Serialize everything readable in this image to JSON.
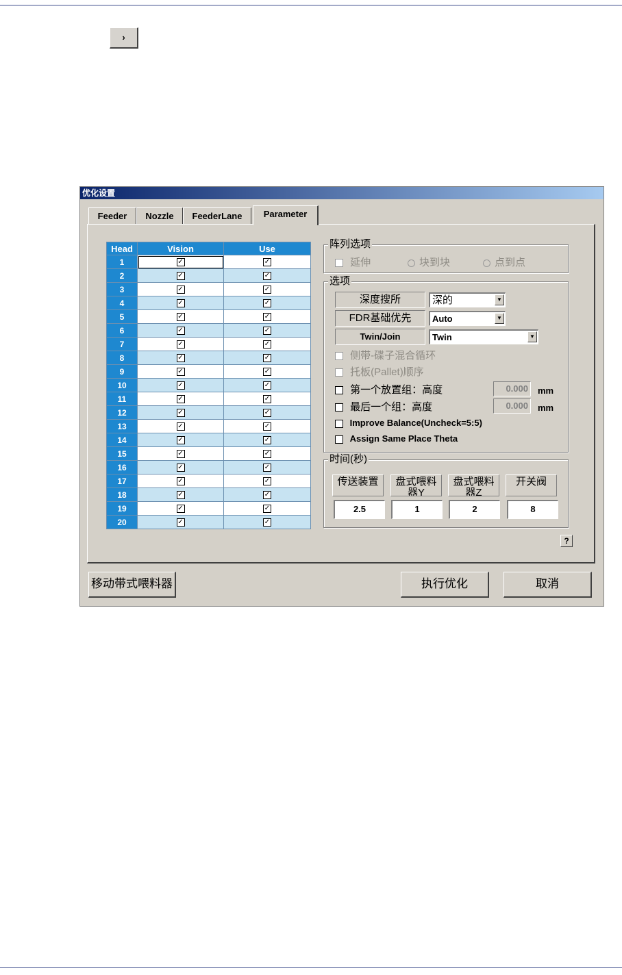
{
  "page": {
    "nav_button_label": "›"
  },
  "dialog": {
    "title": "优化设置",
    "tabs": [
      "Feeder",
      "Nozzle",
      "FeederLane",
      "Parameter"
    ],
    "active_tab": "Parameter",
    "head_table": {
      "columns": [
        "Head",
        "Vision",
        "Use"
      ],
      "rows": [
        {
          "head": "1",
          "vision": true,
          "use": true
        },
        {
          "head": "2",
          "vision": true,
          "use": true
        },
        {
          "head": "3",
          "vision": true,
          "use": true
        },
        {
          "head": "4",
          "vision": true,
          "use": true
        },
        {
          "head": "5",
          "vision": true,
          "use": true
        },
        {
          "head": "6",
          "vision": true,
          "use": true
        },
        {
          "head": "7",
          "vision": true,
          "use": true
        },
        {
          "head": "8",
          "vision": true,
          "use": true
        },
        {
          "head": "9",
          "vision": true,
          "use": true
        },
        {
          "head": "10",
          "vision": true,
          "use": true
        },
        {
          "head": "11",
          "vision": true,
          "use": true
        },
        {
          "head": "12",
          "vision": true,
          "use": true
        },
        {
          "head": "13",
          "vision": true,
          "use": true
        },
        {
          "head": "14",
          "vision": true,
          "use": true
        },
        {
          "head": "15",
          "vision": true,
          "use": true
        },
        {
          "head": "16",
          "vision": true,
          "use": true
        },
        {
          "head": "17",
          "vision": true,
          "use": true
        },
        {
          "head": "18",
          "vision": true,
          "use": true
        },
        {
          "head": "19",
          "vision": true,
          "use": true
        },
        {
          "head": "20",
          "vision": true,
          "use": true
        }
      ]
    },
    "array_options": {
      "legend": "阵列选项",
      "extend_label": "延伸",
      "block_to_block_label": "块到块",
      "point_to_point_label": "点到点"
    },
    "options": {
      "legend": "选项",
      "depth_search_label": "深度搜所",
      "depth_search_value": "深的",
      "fdr_priority_label": "FDR基础优先",
      "fdr_priority_value": "Auto",
      "twin_join_label": "Twin/Join",
      "twin_join_value": "Twin",
      "side_tray_loop_label": "侧带-碟子混合循环",
      "pallet_order_label": "托板(Pallet)顺序",
      "first_group_label": "第一个放置组：高度",
      "first_group_value": "0.000",
      "last_group_label": "最后一个组：高度",
      "last_group_value": "0.000",
      "unit": "mm",
      "improve_balance_label": "Improve Balance(Uncheck=5:5)",
      "assign_theta_label": "Assign Same Place Theta"
    },
    "time": {
      "legend": "时间(秒)",
      "labels": [
        "传送装置",
        "盘式喂料器Y",
        "盘式喂料器Z",
        "开关阀"
      ],
      "values": [
        "2.5",
        "1",
        "2",
        "8"
      ]
    },
    "help_label": "?",
    "buttons": {
      "move_feeder": "移动带式喂料器",
      "execute": "执行优化",
      "cancel": "取消"
    }
  }
}
